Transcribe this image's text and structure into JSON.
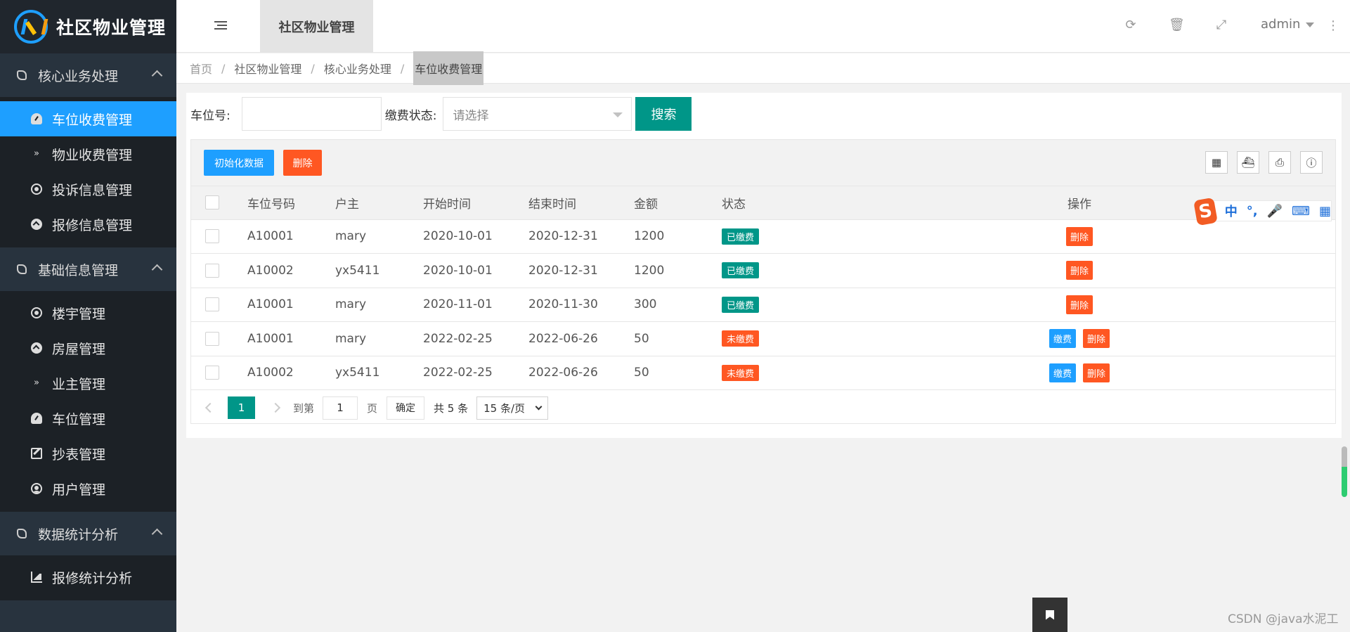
{
  "app": {
    "title": "社区物业管理"
  },
  "sidebar": {
    "groups": [
      {
        "label": "核心业务处理",
        "items": [
          "车位收费管理",
          "物业收费管理",
          "投诉信息管理",
          "报修信息管理"
        ]
      },
      {
        "label": "基础信息管理",
        "items": [
          "楼宇管理",
          "房屋管理",
          "业主管理",
          "车位管理",
          "抄表管理",
          "用户管理"
        ]
      },
      {
        "label": "数据统计分析",
        "items": [
          "报修统计分析"
        ]
      }
    ],
    "active_item": "车位收费管理"
  },
  "header": {
    "tab_label": "社区物业管理",
    "user": "admin",
    "icons": [
      "refresh-icon",
      "trash-icon",
      "fullscreen-icon",
      "more-icon"
    ]
  },
  "breadcrumb": [
    "首页",
    "社区物业管理",
    "核心业务处理",
    "车位收费管理"
  ],
  "search": {
    "space_label": "车位号:",
    "space_value": "",
    "status_label": "缴费状态:",
    "status_placeholder": "请选择",
    "button": "搜索"
  },
  "toolbar": {
    "init_button": "初始化数据",
    "delete_button": "删除",
    "tools": [
      "columns-icon",
      "export-icon",
      "print-icon",
      "info-icon"
    ]
  },
  "table": {
    "headers": [
      "车位号码",
      "户主",
      "开始时间",
      "结束时间",
      "金额",
      "状态",
      "操作"
    ],
    "rows": [
      {
        "code": "A10001",
        "owner": "mary",
        "start": "2020-10-01",
        "end": "2020-12-31",
        "amount": "1200",
        "status": "已缴费",
        "paid": true
      },
      {
        "code": "A10002",
        "owner": "yx5411",
        "start": "2020-10-01",
        "end": "2020-12-31",
        "amount": "1200",
        "status": "已缴费",
        "paid": true
      },
      {
        "code": "A10001",
        "owner": "mary",
        "start": "2020-11-01",
        "end": "2020-11-30",
        "amount": "300",
        "status": "已缴费",
        "paid": true
      },
      {
        "code": "A10001",
        "owner": "mary",
        "start": "2022-02-25",
        "end": "2022-06-26",
        "amount": "50",
        "status": "未缴费",
        "paid": false
      },
      {
        "code": "A10002",
        "owner": "yx5411",
        "start": "2022-02-25",
        "end": "2022-06-26",
        "amount": "50",
        "status": "未缴费",
        "paid": false
      }
    ],
    "op_pay": "缴费",
    "op_delete": "删除"
  },
  "pager": {
    "current": "1",
    "goto_label": "到第",
    "goto_value": "1",
    "page_unit": "页",
    "confirm": "确定",
    "total": "共 5 条",
    "page_size": "15 条/页"
  },
  "ime": {
    "items": [
      "中",
      "°,",
      "mic",
      "keyboard",
      "grid"
    ]
  },
  "watermark": "CSDN @java水泥工",
  "colors": {
    "primary": "#009688",
    "blue": "#1e9fff",
    "danger": "#ff5722",
    "sidebar": "#28333e"
  }
}
